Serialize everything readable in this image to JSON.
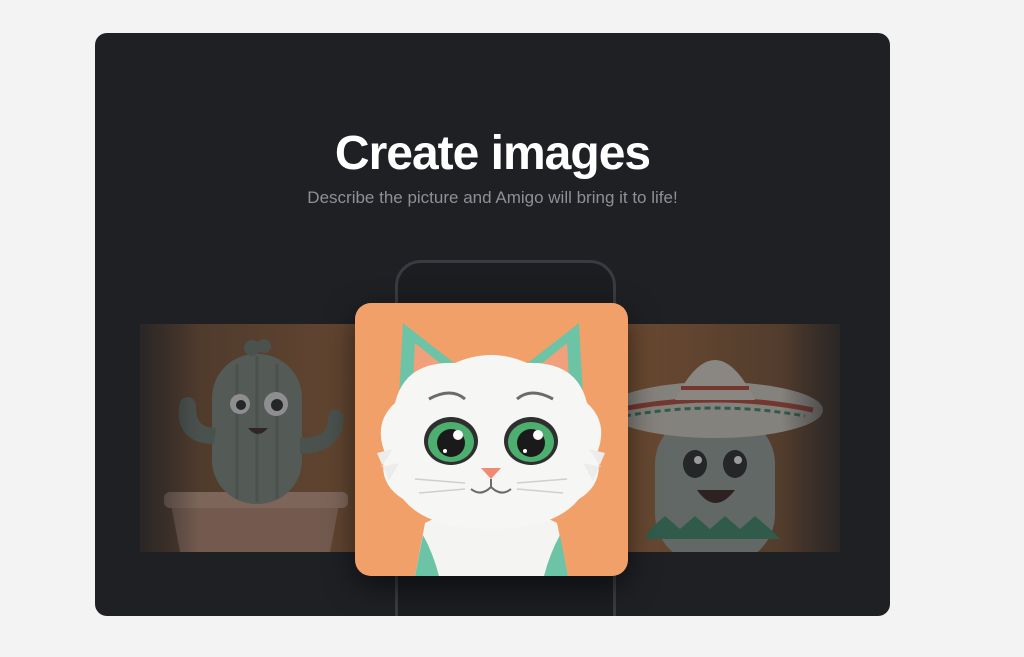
{
  "hero": {
    "title": "Create images",
    "subtitle": "Describe the picture and Amigo will bring it to life!"
  },
  "gallery": {
    "items": [
      {
        "icon": "cactus-illustration"
      },
      {
        "icon": "cat-illustration"
      },
      {
        "icon": "sombrero-character-illustration"
      }
    ]
  },
  "colors": {
    "card_background": "#1f2024",
    "page_background": "#f3f3f3",
    "title": "#ffffff",
    "subtitle": "#8e9096",
    "cat_background": "#f2a06a",
    "accent_green": "#6cc3a6"
  }
}
